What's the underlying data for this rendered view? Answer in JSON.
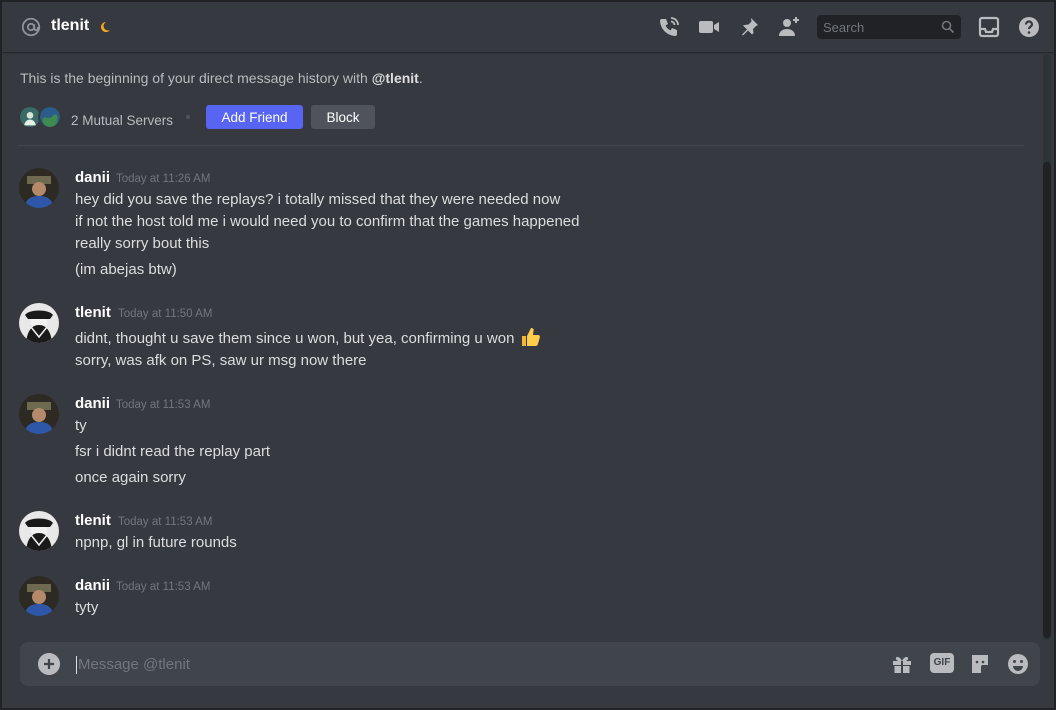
{
  "header": {
    "title": "tlenit",
    "search_placeholder": "Search",
    "icons": [
      "at-icon",
      "moon-status-icon",
      "voice-call-icon",
      "video-call-icon",
      "pin-icon",
      "add-friend-icon",
      "search-icon",
      "inbox-icon",
      "help-icon"
    ]
  },
  "intro": {
    "big_name": "tlenit",
    "text_prefix": "This is the beginning of your direct message history with ",
    "text_handle": "@tlenit",
    "text_suffix": ".",
    "mutual_servers": "2 Mutual Servers",
    "add_friend_label": "Add Friend",
    "block_label": "Block"
  },
  "messages": [
    {
      "author": "danii",
      "timestamp": "Today at 11:26 AM",
      "lines": [
        "hey did you save the replays? i totally missed that they were needed now",
        "if not the host told me i would need you to confirm that the games happened",
        "really sorry bout this",
        "(im abejas btw)"
      ]
    },
    {
      "author": "tlenit",
      "timestamp": "Today at 11:50 AM",
      "lines": [
        "didnt, thought u save them since u won, but yea, confirming u won",
        "sorry, was afk on PS, saw ur msg now there"
      ]
    },
    {
      "author": "danii",
      "timestamp": "Today at 11:53 AM",
      "lines": [
        "ty",
        "fsr i didnt read the replay part",
        "once again sorry"
      ]
    },
    {
      "author": "tlenit",
      "timestamp": "Today at 11:53 AM",
      "lines": [
        "npnp, gl in future rounds"
      ]
    },
    {
      "author": "danii",
      "timestamp": "Today at 11:53 AM",
      "lines": [
        "tyty"
      ]
    }
  ],
  "composer": {
    "placeholder": "Message @tlenit",
    "icons": [
      "attach-plus-icon",
      "gift-icon",
      "gif-icon",
      "sticker-icon",
      "emoji-icon"
    ],
    "gif_label": "GIF"
  },
  "colors": {
    "background": "#36393f",
    "accent": "#5865f2",
    "block_button": "#4f545c",
    "username": "#ffffff",
    "timestamp": "#72767d",
    "status_idle": "#faa81a"
  }
}
